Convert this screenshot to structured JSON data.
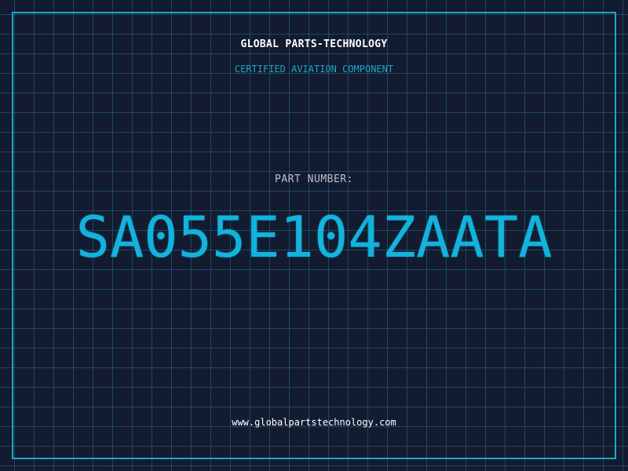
{
  "header": {
    "company": "GLOBAL PARTS-TECHNOLOGY",
    "tagline": "CERTIFIED AVIATION COMPONENT"
  },
  "part": {
    "label": "PART NUMBER:",
    "number": "SA055E104ZAATA"
  },
  "footer": {
    "url": "www.globalpartstechnology.com"
  },
  "colors": {
    "background": "#121b2f",
    "grid": "#286e8c",
    "accent": "#1fa6c8",
    "part_number": "#12b3dd",
    "text": "#ffffff"
  }
}
